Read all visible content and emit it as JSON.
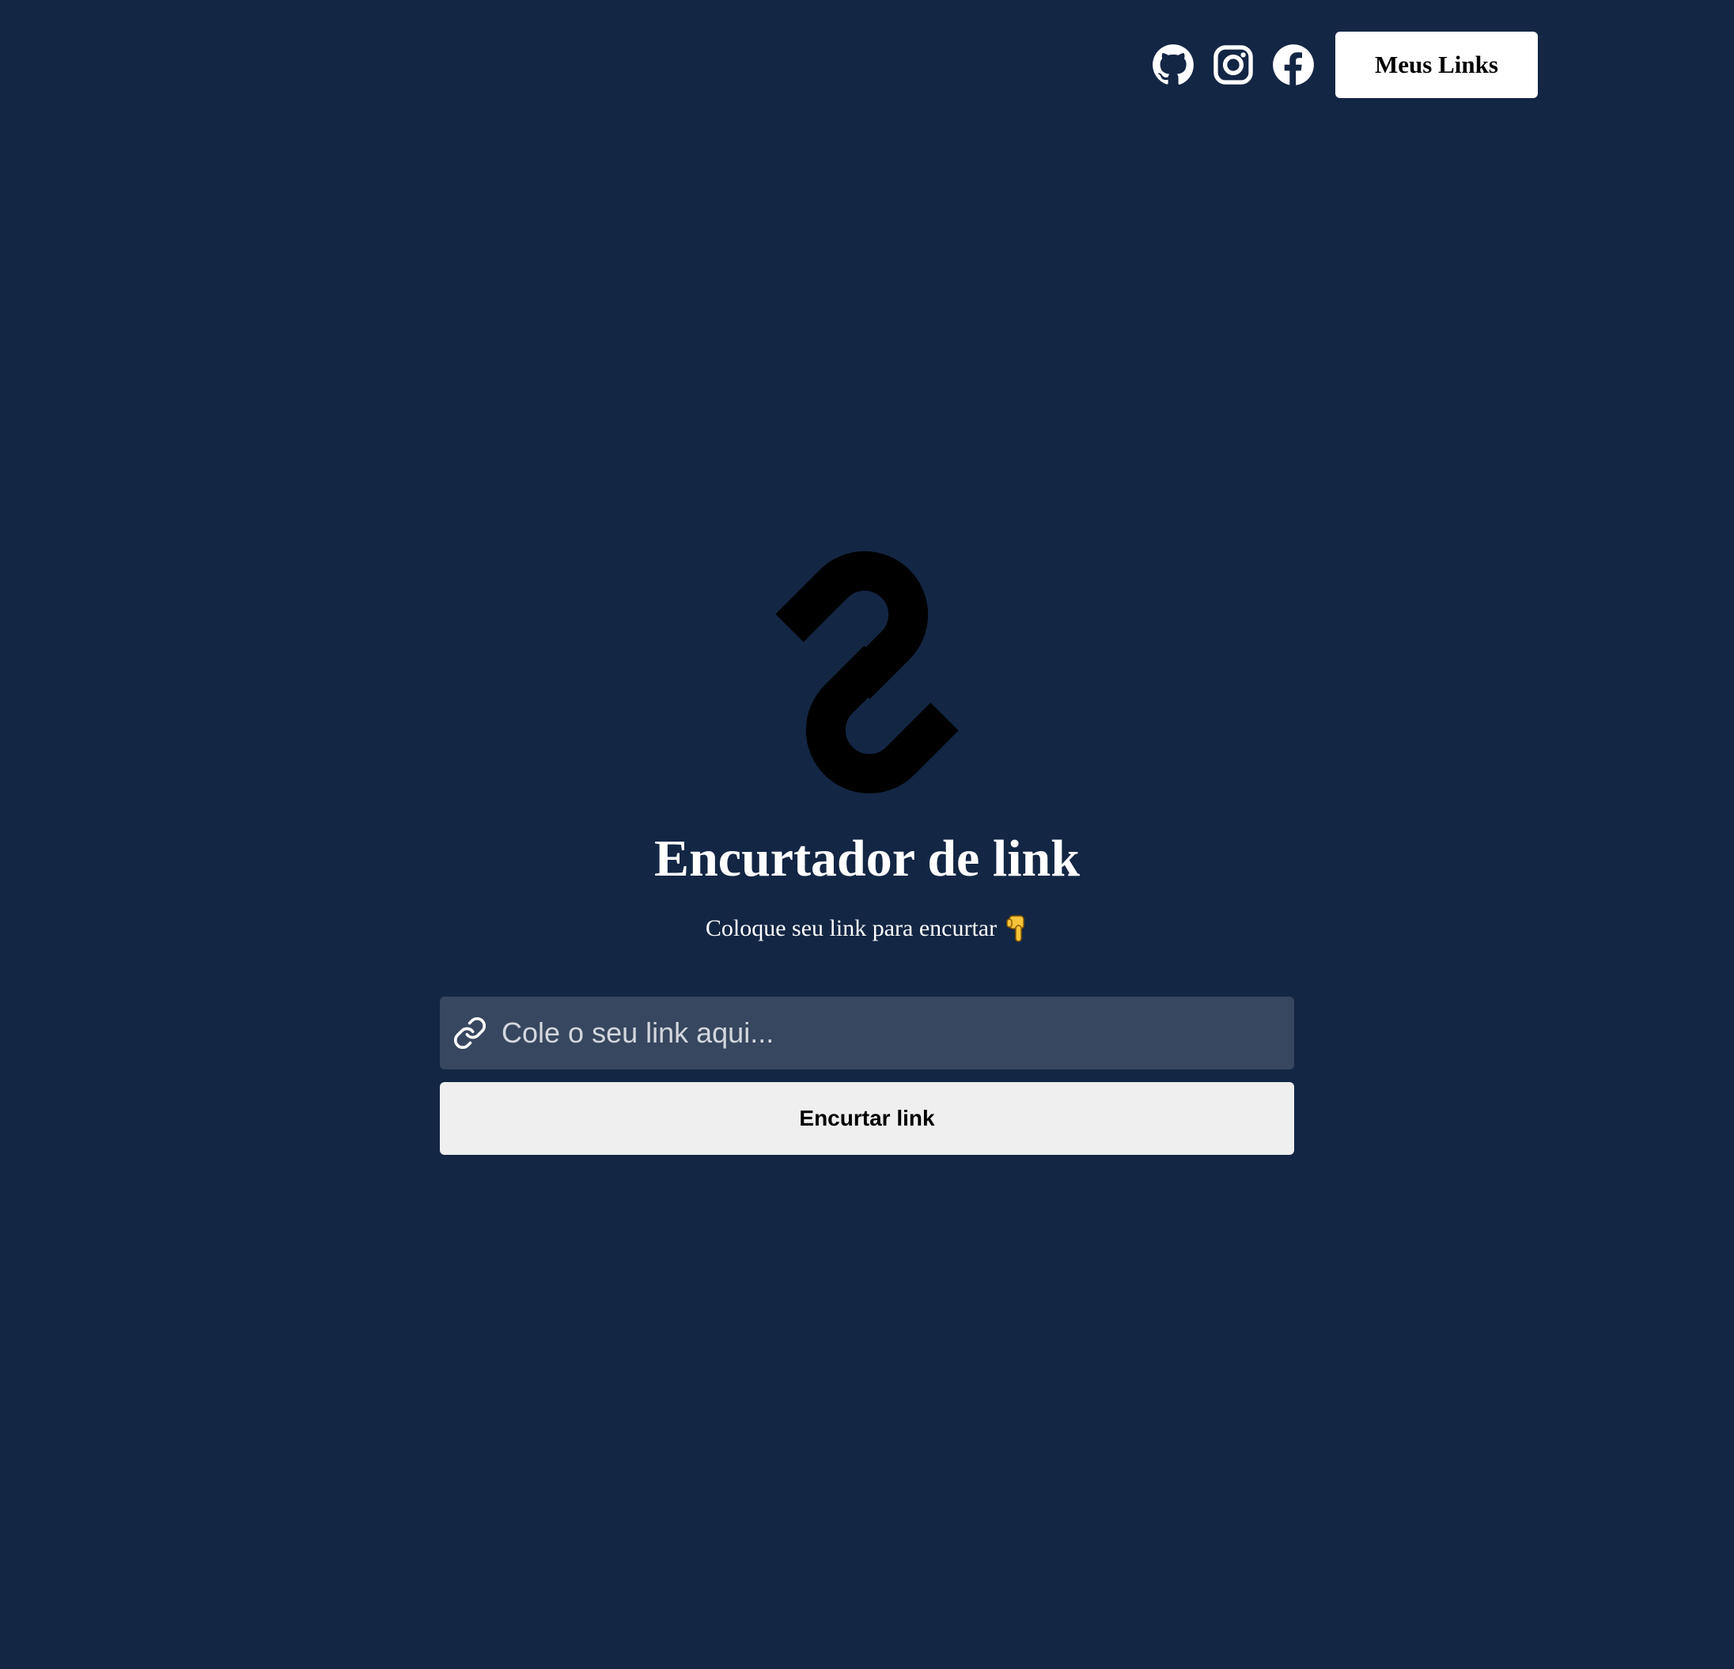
{
  "header": {
    "social": [
      {
        "icon": "github-icon"
      },
      {
        "icon": "instagram-icon"
      },
      {
        "icon": "facebook-icon"
      }
    ],
    "my_links_label": "Meus Links"
  },
  "hero": {
    "logo_icon": "chain-link-icon",
    "title": "Encurtador de link",
    "subtitle": "Coloque seu link para encurtar",
    "subtitle_emoji": "pointing-down-hand-icon"
  },
  "form": {
    "input_icon": "link-icon",
    "input_placeholder": "Cole o seu link aqui...",
    "input_value": "",
    "submit_label": "Encurtar link"
  },
  "colors": {
    "background": "#132644",
    "input_background": "#37475f",
    "button_background": "#efefef",
    "logo": "#000000",
    "text": "#ffffff"
  }
}
